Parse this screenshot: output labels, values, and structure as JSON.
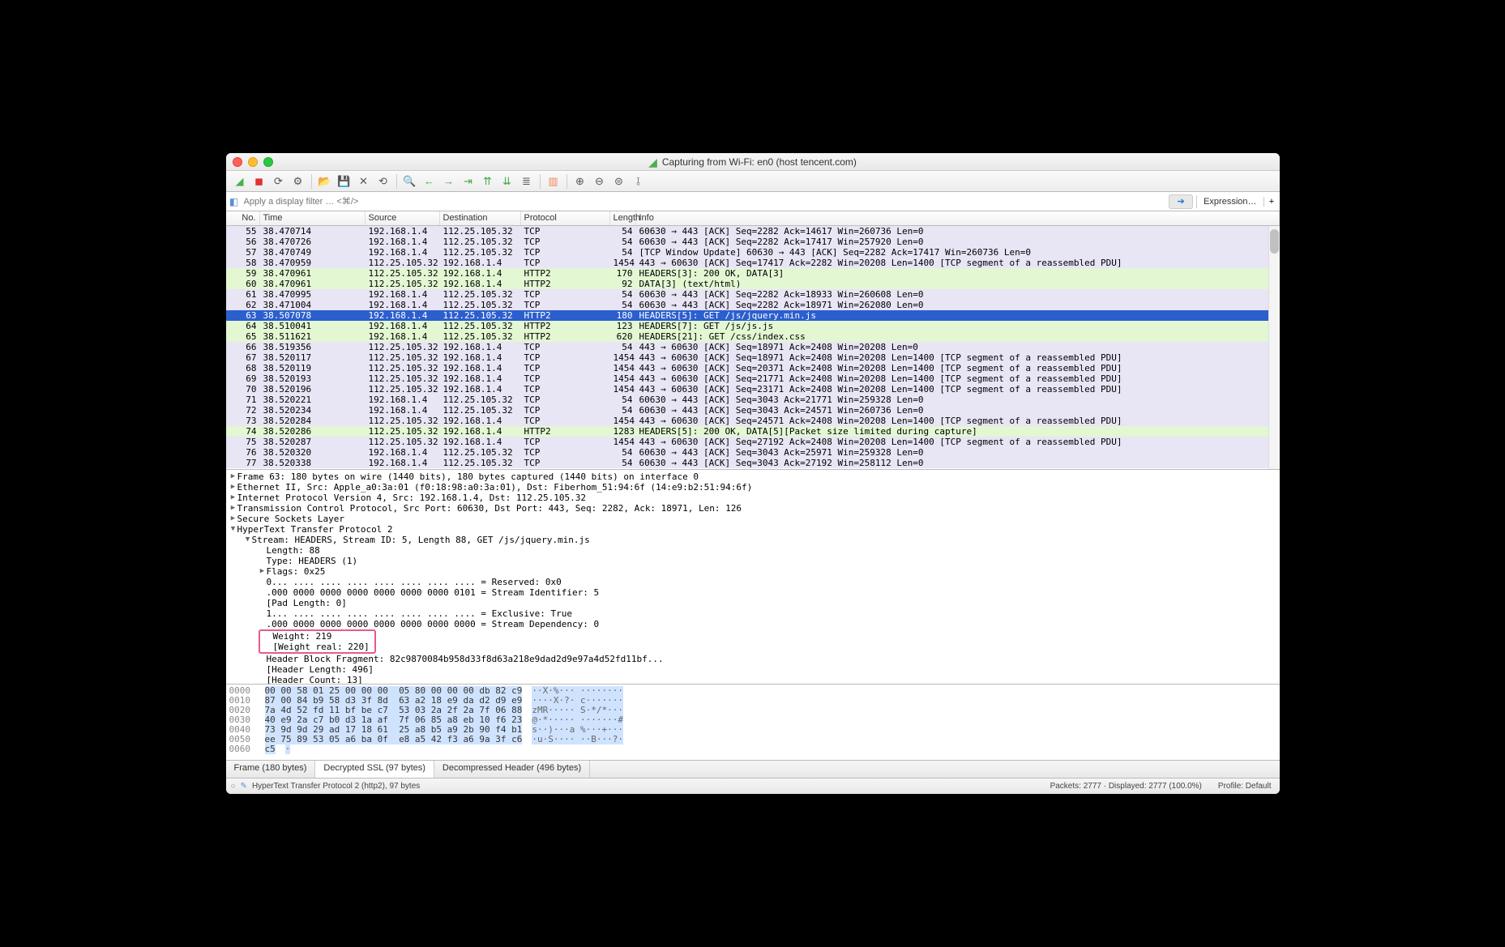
{
  "window_title": "Capturing from Wi-Fi: en0 (host tencent.com)",
  "filter_placeholder": "Apply a display filter … <⌘/>",
  "expression_label": "Expression…",
  "columns": {
    "no": "No.",
    "time": "Time",
    "src": "Source",
    "dst": "Destination",
    "proto": "Protocol",
    "len": "Length",
    "info": "Info"
  },
  "packets": [
    {
      "no": "55",
      "time": "38.470714",
      "src": "192.168.1.4",
      "dst": "112.25.105.32",
      "proto": "TCP",
      "len": "54",
      "info": "60630 → 443 [ACK] Seq=2282 Ack=14617 Win=260736 Len=0",
      "cls": "r-lav"
    },
    {
      "no": "56",
      "time": "38.470726",
      "src": "192.168.1.4",
      "dst": "112.25.105.32",
      "proto": "TCP",
      "len": "54",
      "info": "60630 → 443 [ACK] Seq=2282 Ack=17417 Win=257920 Len=0",
      "cls": "r-lav"
    },
    {
      "no": "57",
      "time": "38.470749",
      "src": "192.168.1.4",
      "dst": "112.25.105.32",
      "proto": "TCP",
      "len": "54",
      "info": "[TCP Window Update] 60630 → 443 [ACK] Seq=2282 Ack=17417 Win=260736 Len=0",
      "cls": "r-lav"
    },
    {
      "no": "58",
      "time": "38.470959",
      "src": "112.25.105.32",
      "dst": "192.168.1.4",
      "proto": "TCP",
      "len": "1454",
      "info": "443 → 60630 [ACK] Seq=17417 Ack=2282 Win=20208 Len=1400 [TCP segment of a reassembled PDU]",
      "cls": "r-lav"
    },
    {
      "no": "59",
      "time": "38.470961",
      "src": "112.25.105.32",
      "dst": "192.168.1.4",
      "proto": "HTTP2",
      "len": "170",
      "info": "HEADERS[3]: 200 OK, DATA[3]",
      "cls": "r-grn"
    },
    {
      "no": "60",
      "time": "38.470961",
      "src": "112.25.105.32",
      "dst": "192.168.1.4",
      "proto": "HTTP2",
      "len": "92",
      "info": "DATA[3] (text/html)",
      "cls": "r-grn"
    },
    {
      "no": "61",
      "time": "38.470995",
      "src": "192.168.1.4",
      "dst": "112.25.105.32",
      "proto": "TCP",
      "len": "54",
      "info": "60630 → 443 [ACK] Seq=2282 Ack=18933 Win=260608 Len=0",
      "cls": "r-lav"
    },
    {
      "no": "62",
      "time": "38.471004",
      "src": "192.168.1.4",
      "dst": "112.25.105.32",
      "proto": "TCP",
      "len": "54",
      "info": "60630 → 443 [ACK] Seq=2282 Ack=18971 Win=262080 Len=0",
      "cls": "r-lav"
    },
    {
      "no": "63",
      "time": "38.507078",
      "src": "192.168.1.4",
      "dst": "112.25.105.32",
      "proto": "HTTP2",
      "len": "180",
      "info": "HEADERS[5]: GET /js/jquery.min.js",
      "cls": "r-sel"
    },
    {
      "no": "64",
      "time": "38.510041",
      "src": "192.168.1.4",
      "dst": "112.25.105.32",
      "proto": "HTTP2",
      "len": "123",
      "info": "HEADERS[7]: GET /js/js.js",
      "cls": "r-grn"
    },
    {
      "no": "65",
      "time": "38.511621",
      "src": "192.168.1.4",
      "dst": "112.25.105.32",
      "proto": "HTTP2",
      "len": "620",
      "info": "HEADERS[21]: GET /css/index.css",
      "cls": "r-grn"
    },
    {
      "no": "66",
      "time": "38.519356",
      "src": "112.25.105.32",
      "dst": "192.168.1.4",
      "proto": "TCP",
      "len": "54",
      "info": "443 → 60630 [ACK] Seq=18971 Ack=2408 Win=20208 Len=0",
      "cls": "r-lav"
    },
    {
      "no": "67",
      "time": "38.520117",
      "src": "112.25.105.32",
      "dst": "192.168.1.4",
      "proto": "TCP",
      "len": "1454",
      "info": "443 → 60630 [ACK] Seq=18971 Ack=2408 Win=20208 Len=1400 [TCP segment of a reassembled PDU]",
      "cls": "r-lav"
    },
    {
      "no": "68",
      "time": "38.520119",
      "src": "112.25.105.32",
      "dst": "192.168.1.4",
      "proto": "TCP",
      "len": "1454",
      "info": "443 → 60630 [ACK] Seq=20371 Ack=2408 Win=20208 Len=1400 [TCP segment of a reassembled PDU]",
      "cls": "r-lav"
    },
    {
      "no": "69",
      "time": "38.520193",
      "src": "112.25.105.32",
      "dst": "192.168.1.4",
      "proto": "TCP",
      "len": "1454",
      "info": "443 → 60630 [ACK] Seq=21771 Ack=2408 Win=20208 Len=1400 [TCP segment of a reassembled PDU]",
      "cls": "r-lav"
    },
    {
      "no": "70",
      "time": "38.520196",
      "src": "112.25.105.32",
      "dst": "192.168.1.4",
      "proto": "TCP",
      "len": "1454",
      "info": "443 → 60630 [ACK] Seq=23171 Ack=2408 Win=20208 Len=1400 [TCP segment of a reassembled PDU]",
      "cls": "r-lav"
    },
    {
      "no": "71",
      "time": "38.520221",
      "src": "192.168.1.4",
      "dst": "112.25.105.32",
      "proto": "TCP",
      "len": "54",
      "info": "60630 → 443 [ACK] Seq=3043 Ack=21771 Win=259328 Len=0",
      "cls": "r-lav"
    },
    {
      "no": "72",
      "time": "38.520234",
      "src": "192.168.1.4",
      "dst": "112.25.105.32",
      "proto": "TCP",
      "len": "54",
      "info": "60630 → 443 [ACK] Seq=3043 Ack=24571 Win=260736 Len=0",
      "cls": "r-lav"
    },
    {
      "no": "73",
      "time": "38.520284",
      "src": "112.25.105.32",
      "dst": "192.168.1.4",
      "proto": "TCP",
      "len": "1454",
      "info": "443 → 60630 [ACK] Seq=24571 Ack=2408 Win=20208 Len=1400 [TCP segment of a reassembled PDU]",
      "cls": "r-lav"
    },
    {
      "no": "74",
      "time": "38.520286",
      "src": "112.25.105.32",
      "dst": "192.168.1.4",
      "proto": "HTTP2",
      "len": "1283",
      "info": "HEADERS[5]: 200 OK, DATA[5][Packet size limited during capture]",
      "cls": "r-grn"
    },
    {
      "no": "75",
      "time": "38.520287",
      "src": "112.25.105.32",
      "dst": "192.168.1.4",
      "proto": "TCP",
      "len": "1454",
      "info": "443 → 60630 [ACK] Seq=27192 Ack=2408 Win=20208 Len=1400 [TCP segment of a reassembled PDU]",
      "cls": "r-lav"
    },
    {
      "no": "76",
      "time": "38.520320",
      "src": "192.168.1.4",
      "dst": "112.25.105.32",
      "proto": "TCP",
      "len": "54",
      "info": "60630 → 443 [ACK] Seq=3043 Ack=25971 Win=259328 Len=0",
      "cls": "r-lav"
    },
    {
      "no": "77",
      "time": "38.520338",
      "src": "192.168.1.4",
      "dst": "112.25.105.32",
      "proto": "TCP",
      "len": "54",
      "info": "60630 → 443 [ACK] Seq=3043 Ack=27192 Win=258112 Len=0",
      "cls": "r-lav"
    }
  ],
  "details": [
    {
      "ind": 0,
      "tri": "▶",
      "txt": "Frame 63: 180 bytes on wire (1440 bits), 180 bytes captured (1440 bits) on interface 0"
    },
    {
      "ind": 0,
      "tri": "▶",
      "txt": "Ethernet II, Src: Apple_a0:3a:01 (f0:18:98:a0:3a:01), Dst: Fiberhom_51:94:6f (14:e9:b2:51:94:6f)"
    },
    {
      "ind": 0,
      "tri": "▶",
      "txt": "Internet Protocol Version 4, Src: 192.168.1.4, Dst: 112.25.105.32"
    },
    {
      "ind": 0,
      "tri": "▶",
      "txt": "Transmission Control Protocol, Src Port: 60630, Dst Port: 443, Seq: 2282, Ack: 18971, Len: 126"
    },
    {
      "ind": 0,
      "tri": "▶",
      "txt": "Secure Sockets Layer"
    },
    {
      "ind": 0,
      "tri": "▼",
      "txt": "HyperText Transfer Protocol 2"
    },
    {
      "ind": 1,
      "tri": "▼",
      "txt": "Stream: HEADERS, Stream ID: 5, Length 88, GET /js/jquery.min.js"
    },
    {
      "ind": 2,
      "tri": "",
      "txt": "Length: 88"
    },
    {
      "ind": 2,
      "tri": "",
      "txt": "Type: HEADERS (1)"
    },
    {
      "ind": 2,
      "tri": "▶",
      "txt": "Flags: 0x25"
    },
    {
      "ind": 2,
      "tri": "",
      "txt": "0... .... .... .... .... .... .... .... = Reserved: 0x0"
    },
    {
      "ind": 2,
      "tri": "",
      "txt": ".000 0000 0000 0000 0000 0000 0000 0101 = Stream Identifier: 5"
    },
    {
      "ind": 2,
      "tri": "",
      "txt": "[Pad Length: 0]"
    },
    {
      "ind": 2,
      "tri": "",
      "txt": "1... .... .... .... .... .... .... .... = Exclusive: True"
    },
    {
      "ind": 2,
      "tri": "",
      "txt": ".000 0000 0000 0000 0000 0000 0000 0000 = Stream Dependency: 0"
    },
    {
      "ind": 2,
      "tri": "",
      "txt": "Weight: 219",
      "hl": true
    },
    {
      "ind": 2,
      "tri": "",
      "txt": "[Weight real: 220]",
      "hl": true
    },
    {
      "ind": 2,
      "tri": "",
      "txt": "Header Block Fragment: 82c9870084b958d33f8d63a218e9dad2d9e97a4d52fd11bf..."
    },
    {
      "ind": 2,
      "tri": "",
      "txt": "[Header Length: 496]"
    },
    {
      "ind": 2,
      "tri": "",
      "txt": "[Header Count: 13]"
    }
  ],
  "hex": [
    {
      "off": "0000",
      "b": "00 00 58 01 25 00 00 00  05 80 00 00 00 db 82 c9",
      "a": "··X·%··· ········",
      "sel": true
    },
    {
      "off": "0010",
      "b": "87 00 84 b9 58 d3 3f 8d  63 a2 18 e9 da d2 d9 e9",
      "a": "····X·?· c·······",
      "sel": true
    },
    {
      "off": "0020",
      "b": "7a 4d 52 fd 11 bf be c7  53 03 2a 2f 2a 7f 06 88",
      "a": "zMR····· S·*/*···",
      "sel": true
    },
    {
      "off": "0030",
      "b": "40 e9 2a c7 b0 d3 1a af  7f 06 85 a8 eb 10 f6 23",
      "a": "@·*····· ·······#",
      "sel": true
    },
    {
      "off": "0040",
      "b": "73 9d 9d 29 ad 17 18 61  25 a8 b5 a9 2b 90 f4 b1",
      "a": "s··)···a %···+···",
      "sel": true
    },
    {
      "off": "0050",
      "b": "ee 75 89 53 05 a6 ba 0f  e8 a5 42 f3 a6 9a 3f c6",
      "a": "·u·S···· ··B···?·",
      "sel": true
    },
    {
      "off": "0060",
      "b": "c5",
      "a": "·",
      "sel": true
    }
  ],
  "bottom_tabs": [
    {
      "label": "Frame (180 bytes)",
      "active": false
    },
    {
      "label": "Decrypted SSL (97 bytes)",
      "active": true
    },
    {
      "label": "Decompressed Header (496 bytes)",
      "active": false
    }
  ],
  "status": {
    "detail": "HyperText Transfer Protocol 2 (http2), 97 bytes",
    "packets": "Packets: 2777 · Displayed: 2777 (100.0%)",
    "profile": "Profile: Default"
  }
}
